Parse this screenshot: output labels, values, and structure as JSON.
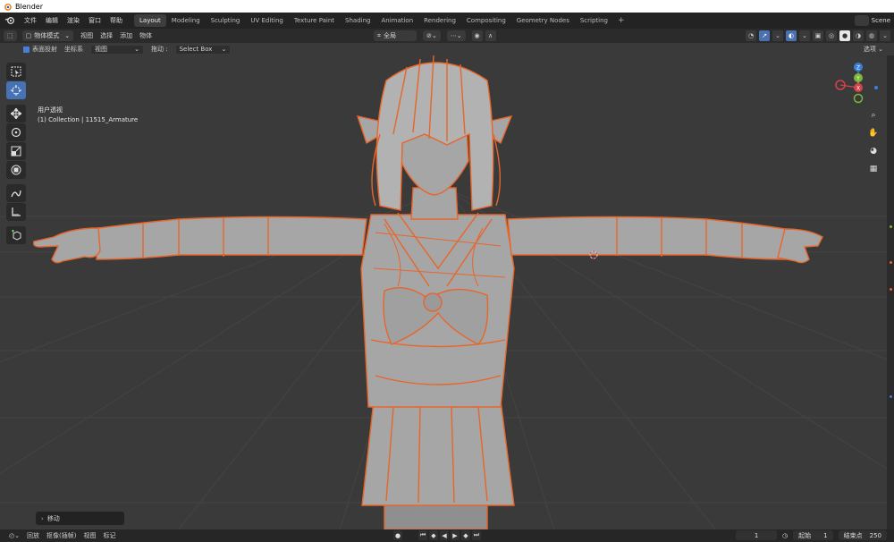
{
  "window": {
    "title": "Blender"
  },
  "topbar": {
    "menus": [
      "文件",
      "编辑",
      "渲染",
      "窗口",
      "帮助"
    ],
    "workspaces": [
      "Layout",
      "Modeling",
      "Sculpting",
      "UV Editing",
      "Texture Paint",
      "Shading",
      "Animation",
      "Rendering",
      "Compositing",
      "Geometry Nodes",
      "Scripting"
    ],
    "active_workspace": "Layout",
    "add_label": "+",
    "scene_label": "Scene"
  },
  "header": {
    "mode": "物体模式",
    "menus": [
      "视图",
      "选择",
      "添加",
      "物体"
    ],
    "transform_orientation": "全局",
    "accent_color": "#4a72b0"
  },
  "tool_options": {
    "checkbox_label": "表面投射",
    "coord_label": "坐标系",
    "coord_value": "视图",
    "drag_label": "拖动 :",
    "drag_value": "Select Box",
    "options_label": "选项"
  },
  "viewport": {
    "view_name": "用户透视",
    "collection_info": "(1) Collection | 11515_Armature",
    "mesh_color": "#a9a9a9",
    "wire_color": "#e8652a"
  },
  "toolbar": {
    "tools": [
      "select-box-icon",
      "cursor-icon",
      "move-icon",
      "rotate-icon",
      "scale-icon",
      "transform-icon",
      "annotate-icon",
      "measure-icon",
      "add-cube-icon"
    ],
    "active_tool": "cursor-icon"
  },
  "gizmo": {
    "axes": [
      "X",
      "Y",
      "Z"
    ],
    "colors": {
      "x": "#d8404c",
      "y": "#7cb63a",
      "z": "#3c7fd8"
    }
  },
  "operator_panel": {
    "label": "移动"
  },
  "timeline": {
    "menus": [
      "回放",
      "抠像(插帧)",
      "视图",
      "标记"
    ],
    "current_frame": "1",
    "start_label": "起始",
    "start_value": "1",
    "end_label": "结束点",
    "end_value": "250"
  }
}
